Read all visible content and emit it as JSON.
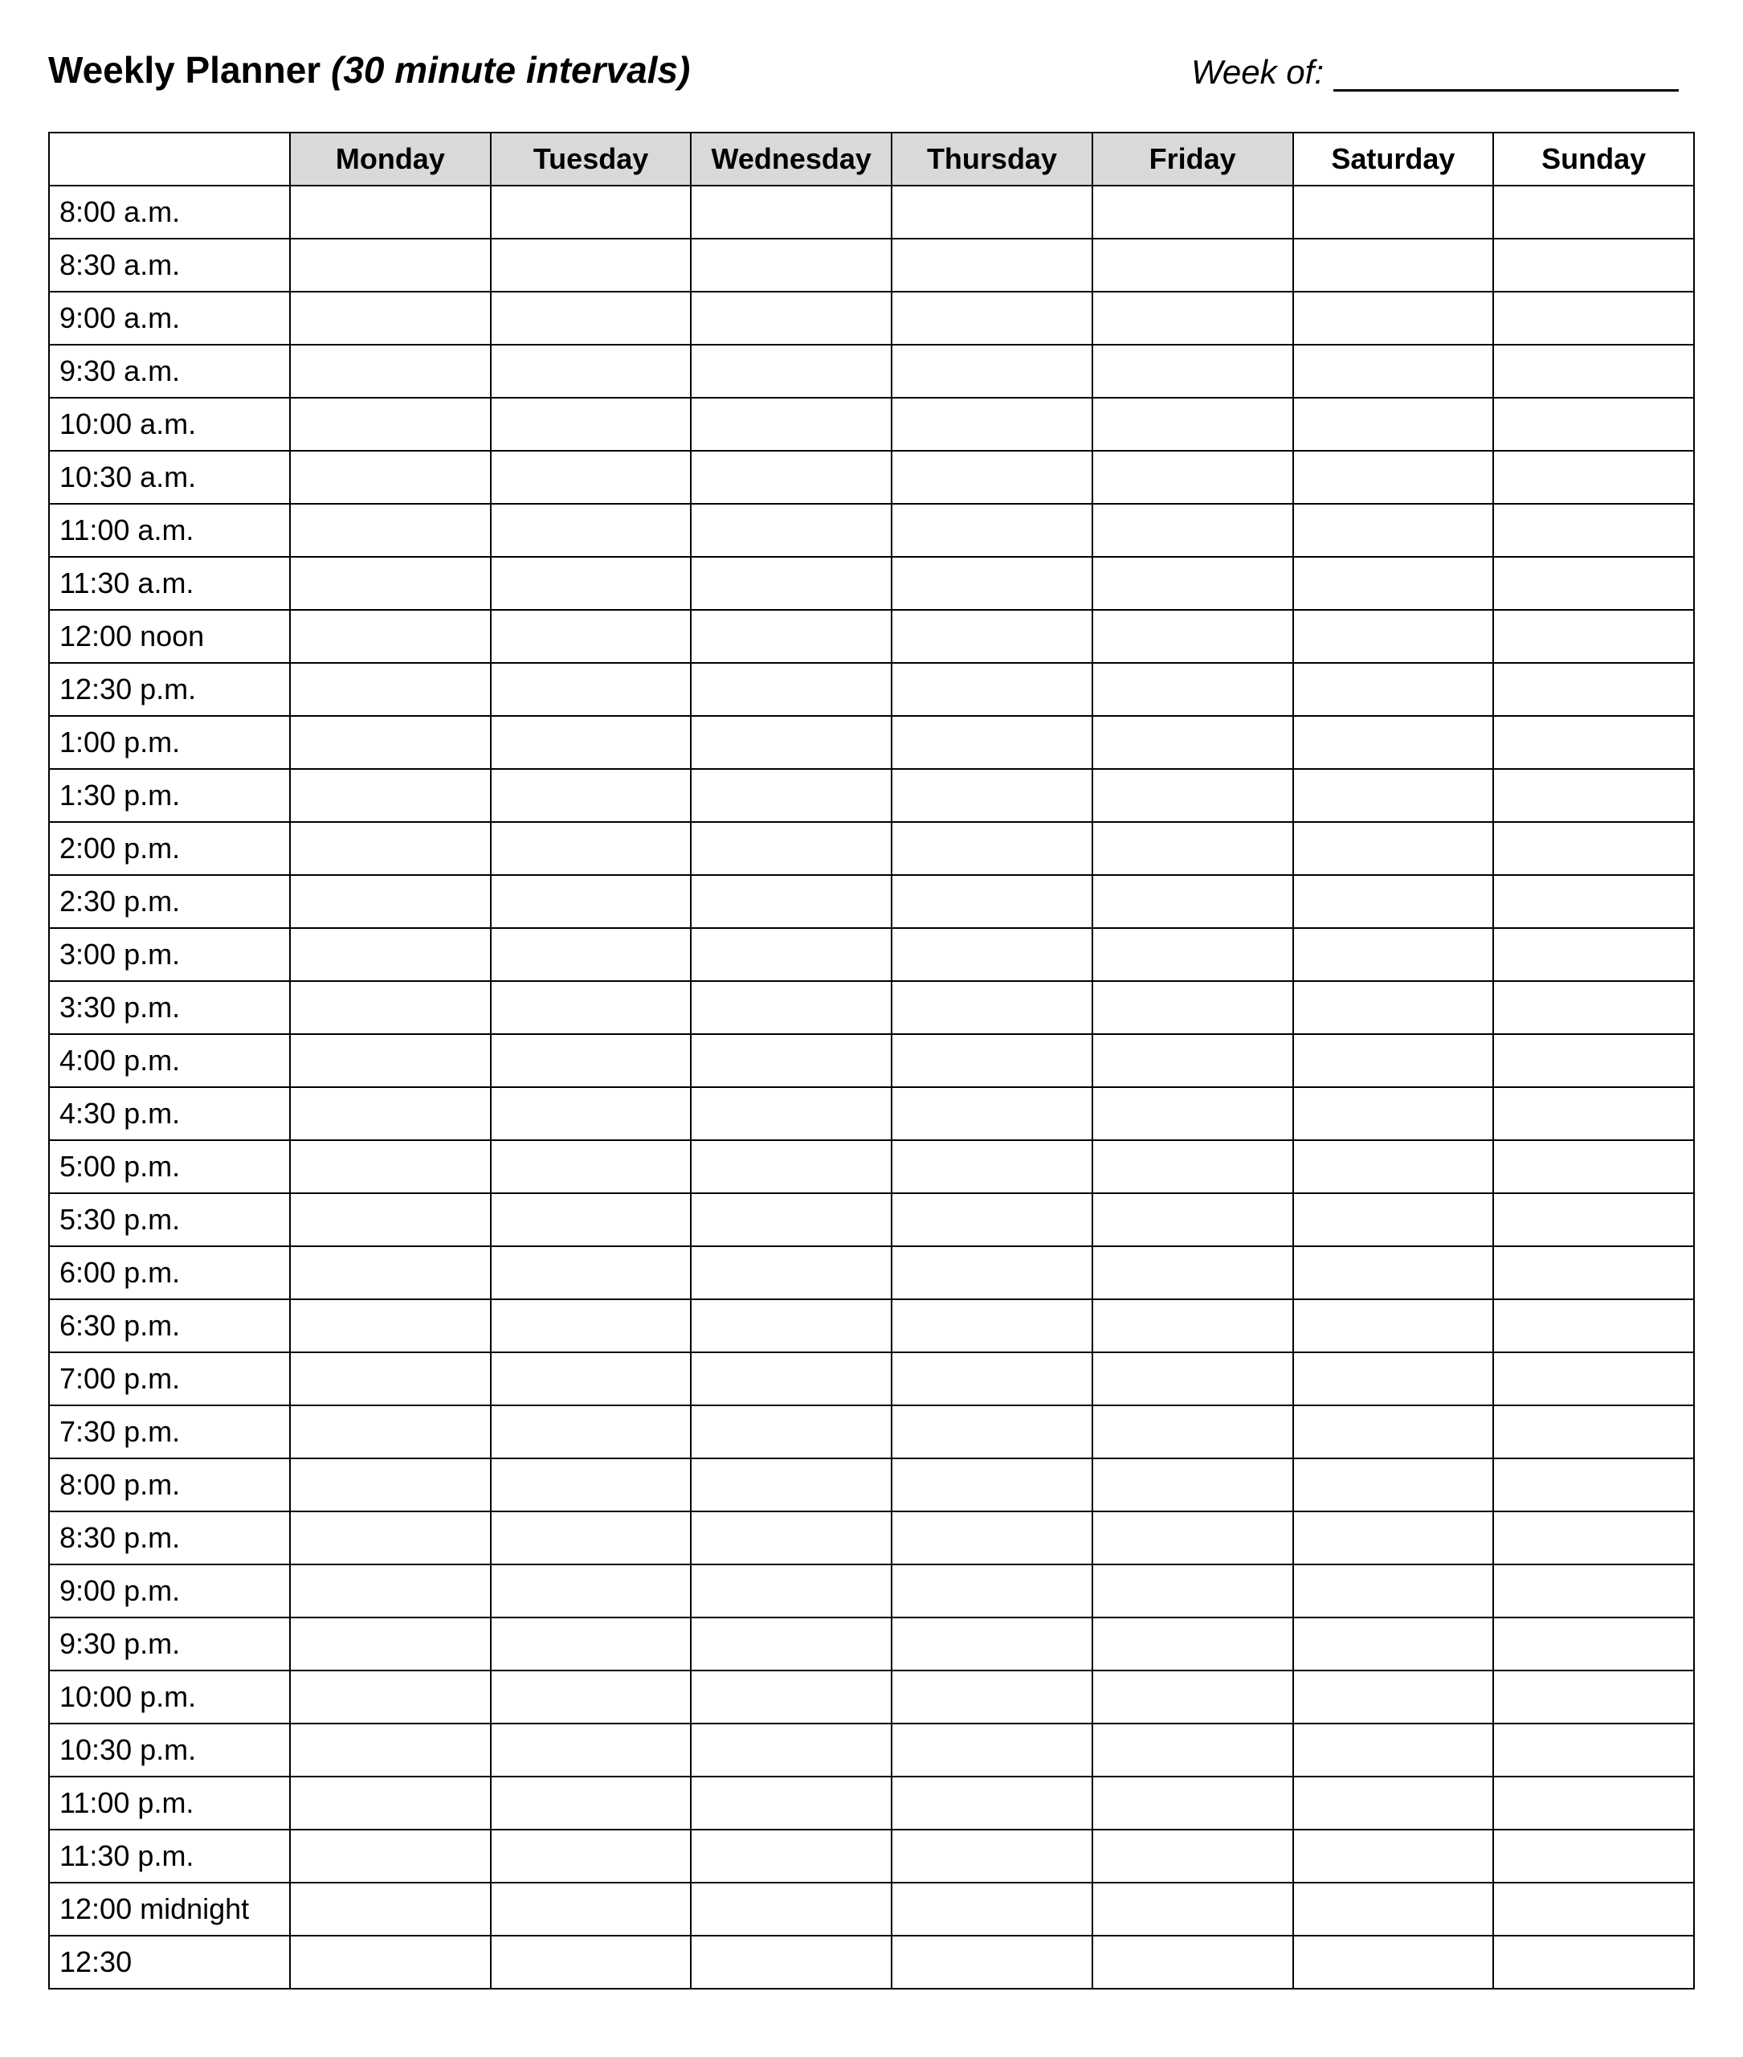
{
  "header": {
    "title": "Weekly Planner",
    "subtitle": "(30 minute intervals)",
    "week_of_label": "Week of:",
    "week_of_value": ""
  },
  "days": [
    {
      "label": "Monday",
      "shaded": true
    },
    {
      "label": "Tuesday",
      "shaded": true
    },
    {
      "label": "Wednesday",
      "shaded": true
    },
    {
      "label": "Thursday",
      "shaded": true
    },
    {
      "label": "Friday",
      "shaded": true
    },
    {
      "label": "Saturday",
      "shaded": false
    },
    {
      "label": "Sunday",
      "shaded": false
    }
  ],
  "time_slots": [
    "8:00 a.m.",
    "8:30 a.m.",
    "9:00 a.m.",
    "9:30 a.m.",
    "10:00 a.m.",
    "10:30 a.m.",
    "11:00 a.m.",
    "11:30 a.m.",
    "12:00 noon",
    "12:30 p.m.",
    "1:00 p.m.",
    "1:30 p.m.",
    "2:00 p.m.",
    "2:30 p.m.",
    "3:00 p.m.",
    "3:30 p.m.",
    "4:00 p.m.",
    "4:30 p.m.",
    "5:00 p.m.",
    "5:30 p.m.",
    "6:00 p.m.",
    "6:30 p.m.",
    "7:00 p.m.",
    "7:30 p.m.",
    "8:00 p.m.",
    "8:30 p.m.",
    "9:00 p.m.",
    "9:30 p.m.",
    "10:00 p.m.",
    "10:30 p.m.",
    "11:00 p.m.",
    "11:30 p.m.",
    "12:00 midnight",
    "12:30"
  ]
}
